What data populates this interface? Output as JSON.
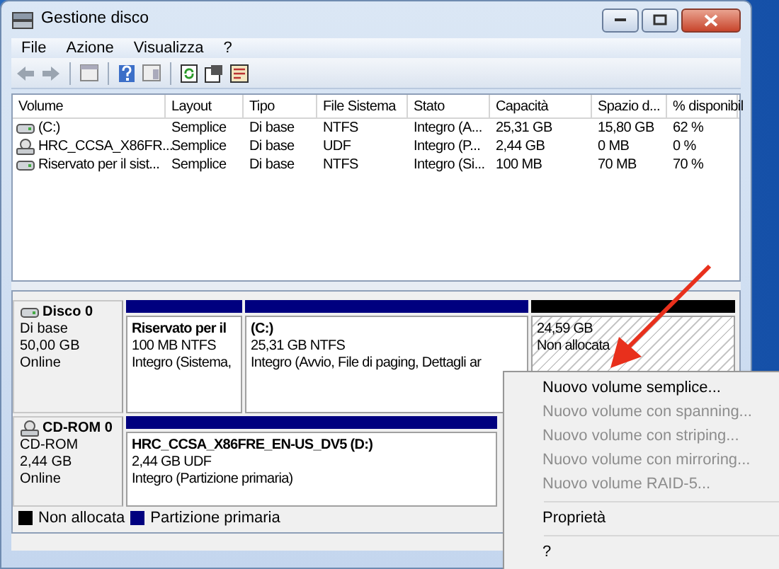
{
  "window": {
    "title": "Gestione disco"
  },
  "menu": [
    "File",
    "Azione",
    "Visualizza",
    "?"
  ],
  "table": {
    "columns": [
      "Volume",
      "Layout",
      "Tipo",
      "File Sistema",
      "Stato",
      "Capacità",
      "Spazio d...",
      "% disponibil"
    ],
    "rows": [
      {
        "kind": "disk",
        "cells": [
          "(C:)",
          "Semplice",
          "Di base",
          "NTFS",
          "Integro (A...",
          "25,31 GB",
          "15,80 GB",
          "62 %"
        ]
      },
      {
        "kind": "cd",
        "cells": [
          "HRC_CCSA_X86FR...",
          "Semplice",
          "Di base",
          "UDF",
          "Integro (P...",
          "2,44 GB",
          "0 MB",
          "0 %"
        ]
      },
      {
        "kind": "disk",
        "cells": [
          "Riservato per il sist...",
          "Semplice",
          "Di base",
          "NTFS",
          "Integro (Si...",
          "100 MB",
          "70 MB",
          "70 %"
        ]
      }
    ]
  },
  "disks": [
    {
      "kind": "disk",
      "name": "Disco 0",
      "type": "Di base",
      "size": "50,00 GB",
      "status": "Online",
      "partitions": [
        {
          "kind": "primary",
          "title": "Riservato per il",
          "detail": "100 MB NTFS",
          "status": "Integro (Sistema,"
        },
        {
          "kind": "primary",
          "title": "(C:)",
          "detail": "25,31 GB NTFS",
          "status": "Integro (Avvio, File di paging, Dettagli ar"
        },
        {
          "kind": "unallocated",
          "detail": "24,59 GB",
          "status": "Non allocata"
        }
      ]
    },
    {
      "kind": "cd",
      "name": "CD-ROM 0",
      "type": "CD-ROM",
      "size": "2,44 GB",
      "status": "Online",
      "partitions": [
        {
          "kind": "primary",
          "title": "HRC_CCSA_X86FRE_EN-US_DV5  (D:)",
          "detail": "2,44 GB UDF",
          "status": "Integro (Partizione primaria)"
        }
      ]
    }
  ],
  "legend": [
    {
      "label": "Non allocata",
      "color": "#000000"
    },
    {
      "label": "Partizione primaria",
      "color": "#00007f"
    }
  ],
  "context_menu": [
    {
      "kind": "item",
      "label": "Nuovo volume semplice...",
      "disabled": false
    },
    {
      "kind": "item",
      "label": "Nuovo volume con spanning...",
      "disabled": true
    },
    {
      "kind": "item",
      "label": "Nuovo volume con striping...",
      "disabled": true
    },
    {
      "kind": "item",
      "label": "Nuovo volume con mirroring...",
      "disabled": true
    },
    {
      "kind": "item",
      "label": "Nuovo volume RAID-5...",
      "disabled": true
    },
    {
      "kind": "separator"
    },
    {
      "kind": "item",
      "label": "Proprietà",
      "disabled": false
    },
    {
      "kind": "separator"
    },
    {
      "kind": "item",
      "label": "?",
      "disabled": false
    }
  ]
}
